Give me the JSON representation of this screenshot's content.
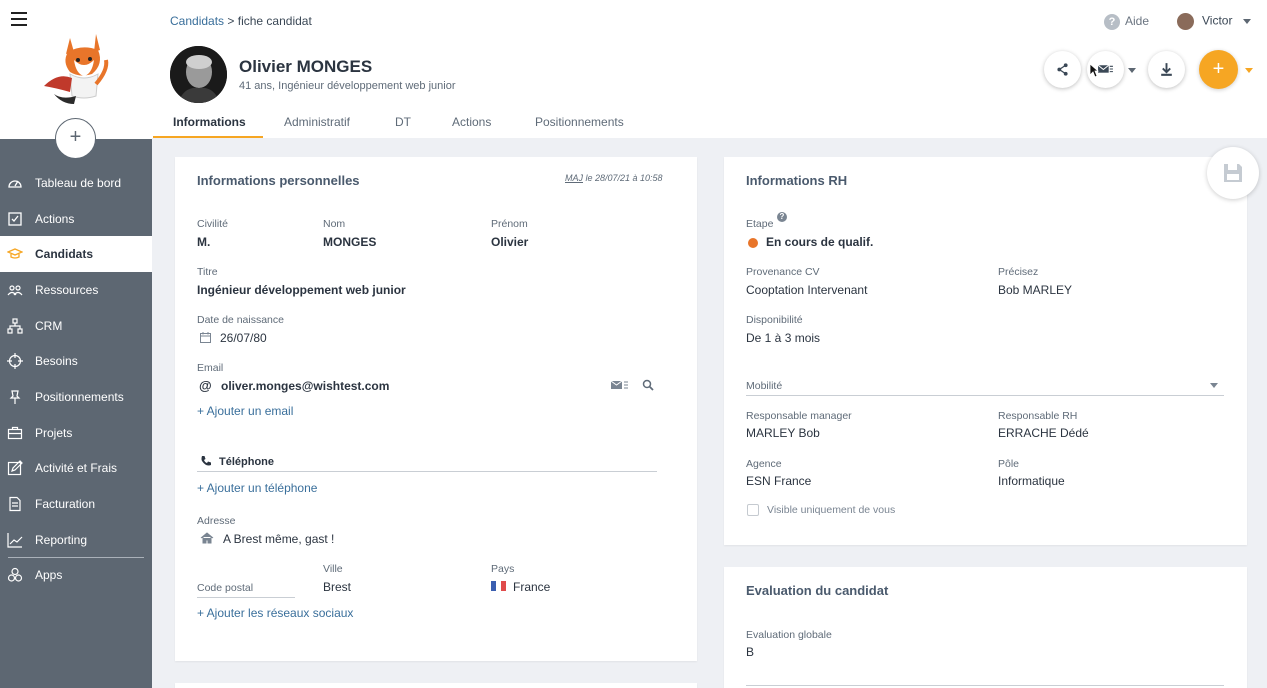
{
  "sidebar": {
    "add_label": "+",
    "items": [
      {
        "label": "Tableau de bord",
        "icon": "dashboard-icon"
      },
      {
        "label": "Actions",
        "icon": "checklist-icon"
      },
      {
        "label": "Candidats",
        "icon": "graduation-cap-icon"
      },
      {
        "label": "Ressources",
        "icon": "people-icon"
      },
      {
        "label": "CRM",
        "icon": "org-chart-icon"
      },
      {
        "label": "Besoins",
        "icon": "target-icon"
      },
      {
        "label": "Positionnements",
        "icon": "pin-icon"
      },
      {
        "label": "Projets",
        "icon": "briefcase-icon"
      },
      {
        "label": "Activité et Frais",
        "icon": "edit-icon"
      },
      {
        "label": "Facturation",
        "icon": "invoice-icon"
      },
      {
        "label": "Reporting",
        "icon": "chart-line-icon"
      },
      {
        "label": "Apps",
        "icon": "apps-icon"
      }
    ]
  },
  "header": {
    "breadcrumb_link": "Candidats",
    "breadcrumb_sep": " > ",
    "breadcrumb_current": "fiche candidat",
    "help_label": "Aide",
    "user_name": "Victor"
  },
  "candidate": {
    "name": "Olivier MONGES",
    "subtitle": "41 ans, Ingénieur développement web junior",
    "plus_label": "+"
  },
  "tabs": [
    {
      "label": "Informations"
    },
    {
      "label": "Administratif"
    },
    {
      "label": "DT"
    },
    {
      "label": "Actions"
    },
    {
      "label": "Positionnements"
    }
  ],
  "personal": {
    "title": "Informations personnelles",
    "maj_prefix": "MAJ",
    "maj_text": " le 28/07/21 à 10:58",
    "civilite_label": "Civilité",
    "civilite": "M.",
    "nom_label": "Nom",
    "nom": "MONGES",
    "prenom_label": "Prénom",
    "prenom": "Olivier",
    "titre_label": "Titre",
    "titre": "Ingénieur développement web junior",
    "birth_label": "Date de naissance",
    "birth": "26/07/80",
    "email_label": "Email",
    "email": "oliver.monges@wishtest.com",
    "add_email": "+ Ajouter un email",
    "phone_label": "Téléphone",
    "add_phone": "+ Ajouter un téléphone",
    "address_label": "Adresse",
    "address": "A Brest même, gast !",
    "postal_label": "Code postal",
    "city_label": "Ville",
    "city": "Brest",
    "country_label": "Pays",
    "country": "France",
    "add_social": "+ Ajouter les réseaux sociaux"
  },
  "rh": {
    "title": "Informations RH",
    "etape_label": "Etape",
    "etape": "En cours de qualif.",
    "provenance_label": "Provenance CV",
    "provenance": "Cooptation Intervenant",
    "precisez_label": "Précisez",
    "precisez": "Bob MARLEY",
    "dispo_label": "Disponibilité",
    "dispo": "De 1 à 3 mois",
    "mobilite_label": "Mobilité",
    "manager_label": "Responsable manager",
    "manager": "MARLEY Bob",
    "resp_rh_label": "Responsable RH",
    "resp_rh": "ERRACHE Dédé",
    "agence_label": "Agence",
    "agence": "ESN France",
    "pole_label": "Pôle",
    "pole": "Informatique",
    "visible_label": "Visible uniquement de vous",
    "etape_color": "#e8752a"
  },
  "evaluation": {
    "title": "Evaluation du candidat",
    "globale_label": "Evaluation globale",
    "globale": "B"
  },
  "colors": {
    "accent": "#f6a623",
    "sidebar": "#5d6772",
    "link": "#3a6f9b"
  }
}
